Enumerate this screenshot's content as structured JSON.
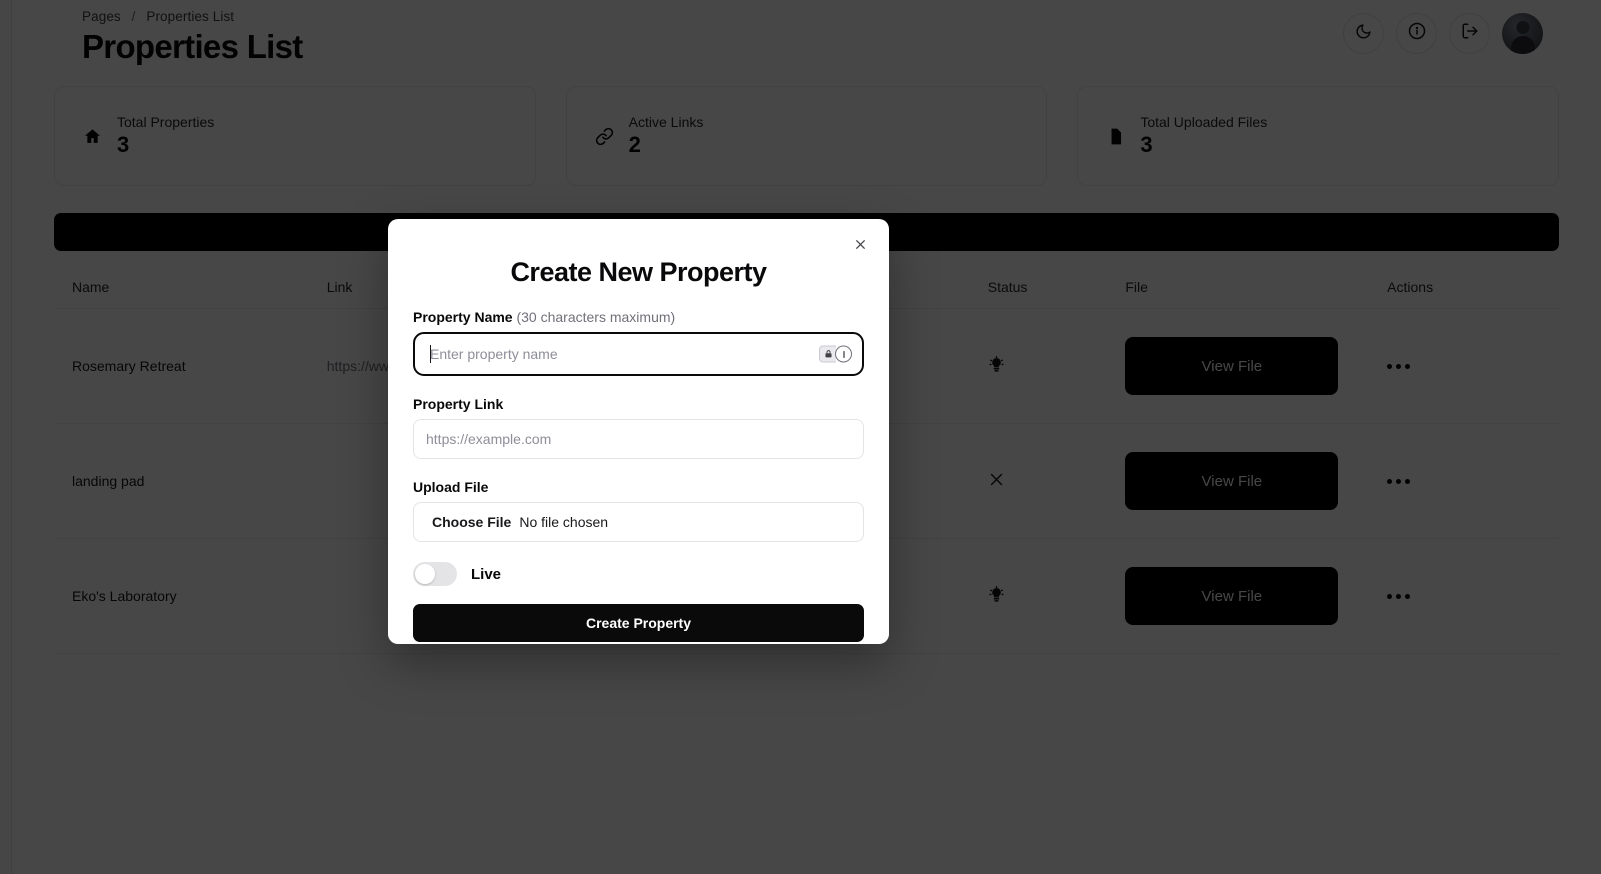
{
  "breadcrumb": {
    "root": "Pages",
    "separator": "/",
    "current": "Properties List"
  },
  "header": {
    "title": "Properties List",
    "actions": [
      {
        "name": "dark-mode-toggle",
        "icon": "moon-icon"
      },
      {
        "name": "info-button",
        "icon": "info-circle-icon"
      },
      {
        "name": "logout-button",
        "icon": "logout-icon"
      },
      {
        "name": "profile-avatar",
        "icon": "avatar"
      }
    ]
  },
  "stats": [
    {
      "icon": "home-icon",
      "label": "Total Properties",
      "value": "3"
    },
    {
      "icon": "link-icon",
      "label": "Active Links",
      "value": "2"
    },
    {
      "icon": "file-icon",
      "label": "Total Uploaded Files",
      "value": "3"
    }
  ],
  "create_bar": {
    "label": ""
  },
  "table": {
    "columns": [
      "Name",
      "Link",
      "Status",
      "File",
      "Actions"
    ],
    "rows": [
      {
        "name": "Rosemary Retreat",
        "link": "https://ww",
        "status_icon": "lightbulb-icon",
        "file_label": "View File",
        "actions_icon": "ellipsis-icon"
      },
      {
        "name": "landing pad",
        "link": "",
        "status_icon": "x-icon",
        "file_label": "View File",
        "actions_icon": "ellipsis-icon"
      },
      {
        "name": "Eko's Laboratory",
        "link": "",
        "status_icon": "lightbulb-icon",
        "file_label": "View File",
        "actions_icon": "ellipsis-icon"
      }
    ]
  },
  "modal": {
    "title": "Create New Property",
    "close_icon": "close-icon",
    "property_name": {
      "label": "Property Name",
      "hint": "(30 characters maximum)",
      "placeholder": "Enter property name",
      "value": ""
    },
    "property_link": {
      "label": "Property Link",
      "placeholder": "https://example.com",
      "value": ""
    },
    "upload_file": {
      "label": "Upload File",
      "button_label": "Choose File",
      "status": "No file chosen"
    },
    "live_toggle": {
      "label": "Live",
      "state": "off"
    },
    "submit": {
      "label": "Create Property"
    }
  },
  "colors": {
    "accent": "#000000",
    "page_bg": "#ffffff",
    "muted_text": "#71717a",
    "border": "#e4e4e7",
    "overlay": "rgba(0,0,0,0.72)"
  }
}
